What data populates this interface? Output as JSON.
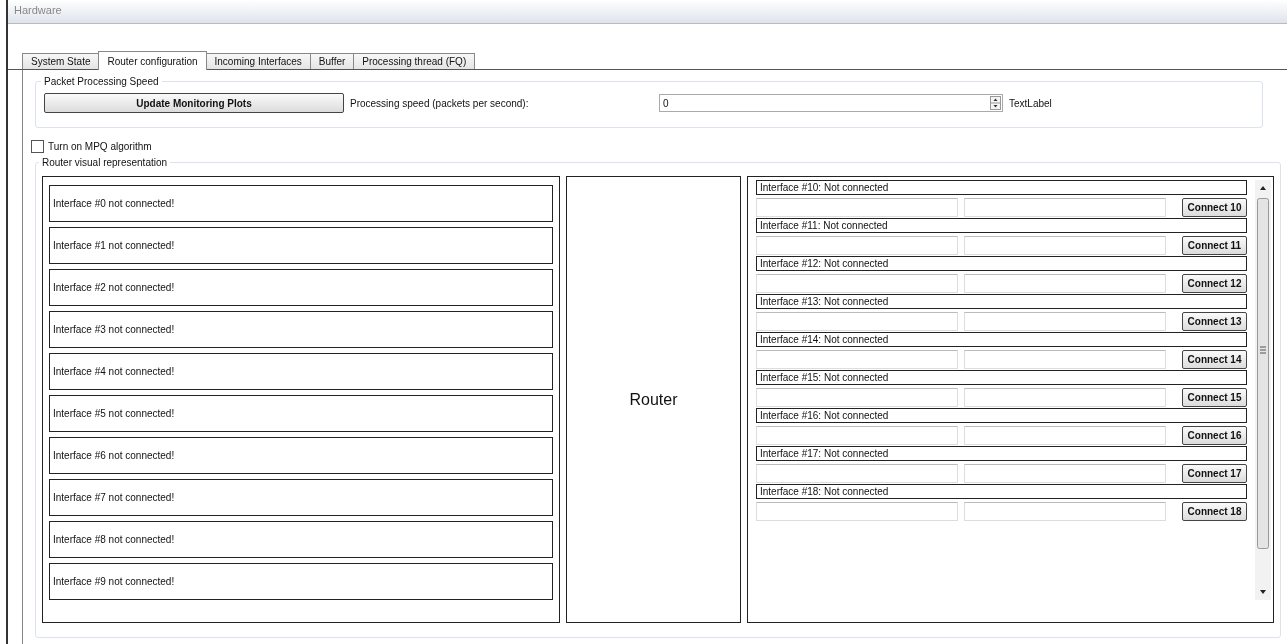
{
  "window": {
    "title": "Hardware"
  },
  "tabs": [
    {
      "label": "System State",
      "selected": false
    },
    {
      "label": "Router configuration",
      "selected": true
    },
    {
      "label": "Incoming Interfaces",
      "selected": false
    },
    {
      "label": "Buffer",
      "selected": false
    },
    {
      "label": "Processing thread (FQ)",
      "selected": false
    }
  ],
  "speed_group": {
    "title": "Packet Processing Speed",
    "button": "Update Monitoring Plots",
    "label": "Processing speed (packets per second):",
    "value": "0",
    "text_label": "TextLabel"
  },
  "mpq_checkbox": {
    "label": "Turn on MPQ algorithm",
    "checked": false
  },
  "router_group": {
    "title": "Router visual representation",
    "router_label": "Router",
    "left_interfaces": [
      "Interface #0 not connected!",
      "Interface #1 not connected!",
      "Interface #2 not connected!",
      "Interface #3 not connected!",
      "Interface #4 not connected!",
      "Interface #5 not connected!",
      "Interface #6 not connected!",
      "Interface #7 not connected!",
      "Interface #8 not connected!",
      "Interface #9 not connected!"
    ],
    "right_interfaces": [
      {
        "status": "Interface #10: Not connected",
        "button": "Connect 10"
      },
      {
        "status": "Interface #11: Not connected",
        "button": "Connect 11"
      },
      {
        "status": "Interface #12: Not connected",
        "button": "Connect 12"
      },
      {
        "status": "Interface #13: Not connected",
        "button": "Connect 13"
      },
      {
        "status": "Interface #14: Not connected",
        "button": "Connect 14"
      },
      {
        "status": "Interface #15: Not connected",
        "button": "Connect 15"
      },
      {
        "status": "Interface #16: Not connected",
        "button": "Connect 16"
      },
      {
        "status": "Interface #17: Not connected",
        "button": "Connect 17"
      },
      {
        "status": "Interface #18: Not connected",
        "button": "Connect 18"
      }
    ]
  }
}
